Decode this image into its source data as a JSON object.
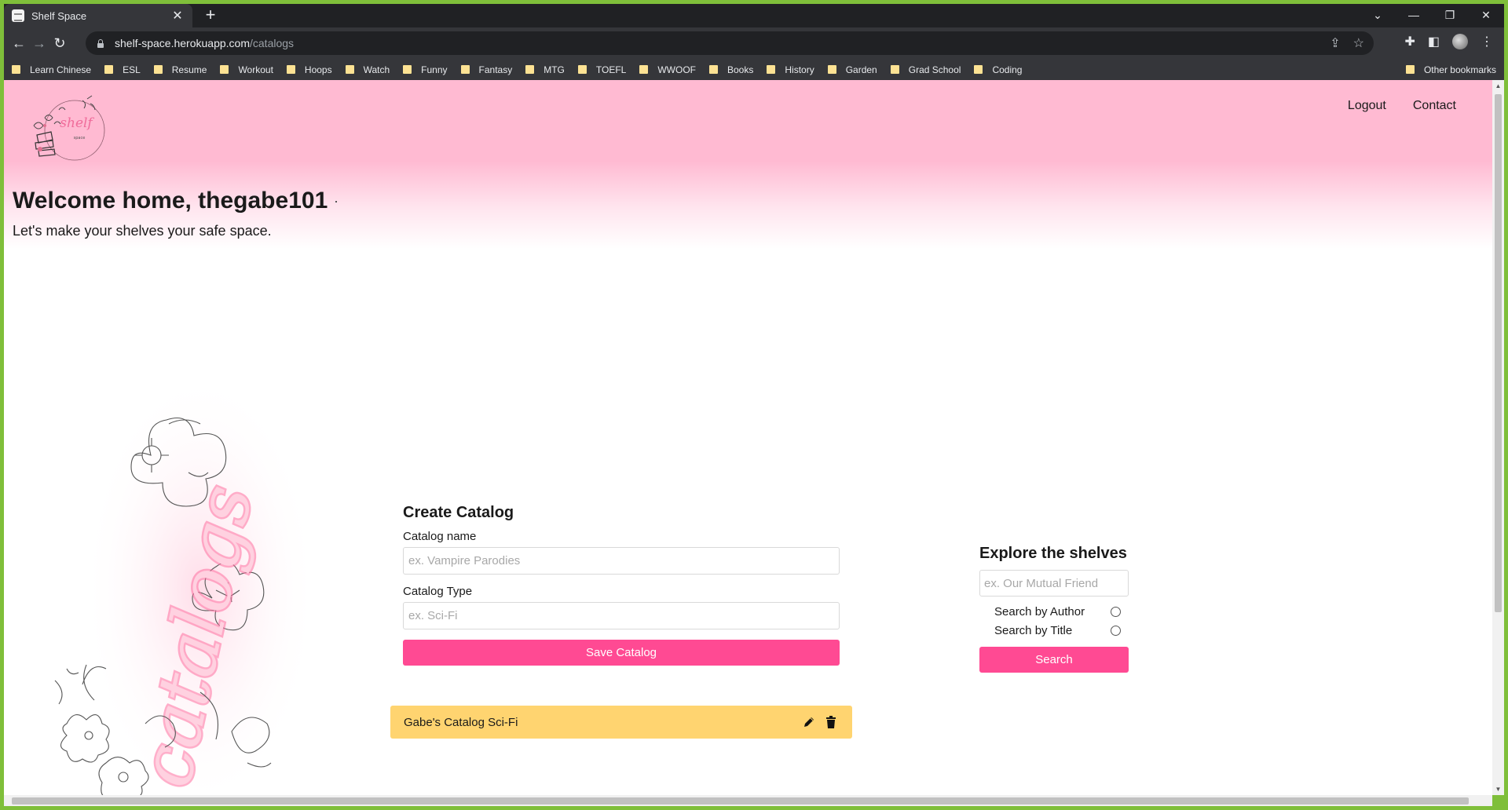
{
  "browser": {
    "tab_title": "Shelf Space",
    "tab_close_icon": "close-icon",
    "new_tab_label": "+",
    "url_host": "shelf-space.herokuapp.com",
    "url_path": "/catalogs",
    "bookmarks": [
      "Learn Chinese",
      "ESL",
      "Resume",
      "Workout",
      "Hoops",
      "Watch",
      "Funny",
      "Fantasy",
      "MTG",
      "TOEFL",
      "WWOOF",
      "Books",
      "History",
      "Garden",
      "Grad School",
      "Coding"
    ],
    "other_bookmarks": "Other bookmarks"
  },
  "header": {
    "logo_text": "shelf",
    "logo_subtext": "space",
    "nav": {
      "logout": "Logout",
      "contact": "Contact"
    },
    "welcome": "Welcome home, thegabe101",
    "tagline": "Let's make your shelves your safe space."
  },
  "decor": {
    "script_text": "catalogs"
  },
  "create_catalog": {
    "title": "Create Catalog",
    "name_label": "Catalog name",
    "name_placeholder": "ex. Vampire Parodies",
    "type_label": "Catalog Type",
    "type_placeholder": "ex. Sci-Fi",
    "save_label": "Save Catalog"
  },
  "catalogs": [
    {
      "text": "Gabe's Catalog Sci-Fi"
    }
  ],
  "explore": {
    "title": "Explore the shelves",
    "search_placeholder": "ex. Our Mutual Friend",
    "by_author_label": "Search by Author",
    "by_title_label": "Search by Title",
    "search_label": "Search"
  },
  "colors": {
    "hero_pink": "#ffbad2",
    "accent_pink": "#ff4a93",
    "catalog_yellow": "#ffd470"
  }
}
